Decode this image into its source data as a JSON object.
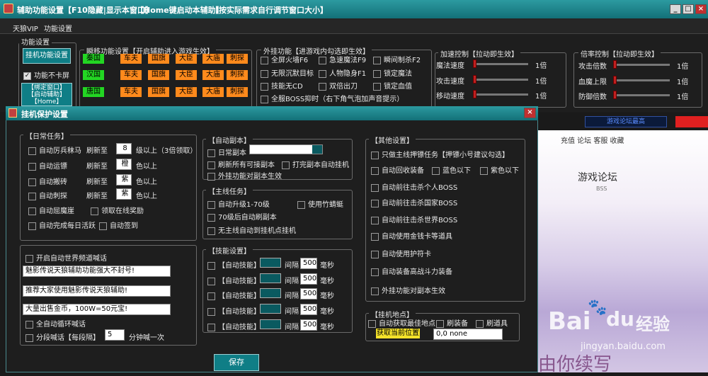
{
  "main_window": {
    "title": "辅助功能设置",
    "hint1": "【F10隐藏|显示本窗口】",
    "hint2": "【Home键启动本辅助】",
    "hint3": "【按实际需求自行调节窗口大小】",
    "min": "_",
    "max": "□",
    "close": "×"
  },
  "menu": [
    "天狼VIP",
    "功能设置"
  ],
  "func_group": {
    "label": "功能设置",
    "hang_button": "挂机功能设置",
    "no_flicker": "功能不卡屏",
    "bind_button": "【绑定窗口】\n【启动辅助】\n【Home】"
  },
  "instant": {
    "label": "瞬移功能设置【开启辅助进入游戏生效】",
    "row1": [
      "秦国",
      "车夫",
      "国旗",
      "大臣",
      "大庙",
      "刺探"
    ],
    "row2": [
      "汉国",
      "车夫",
      "国旗",
      "大臣",
      "大庙",
      "刺探"
    ],
    "row3": [
      "唐国",
      "车夫",
      "国旗",
      "大臣",
      "大庙",
      "刺探"
    ]
  },
  "plugin": {
    "label": "外挂功能【进游戏内勾选即生效】",
    "items": [
      "全屏火墙F6",
      "急速魔法F9",
      "瞬间制杀F2",
      "无限沉默目标",
      "人物隐身F1",
      "锁定魔法",
      "技能无CD",
      "双倍出刀",
      "锁定血值"
    ],
    "boss": "全服BOSS抑时（右下角气泡加声音提示）"
  },
  "speed": {
    "label": "加速控制【拉动即生效】",
    "rows": [
      {
        "label": "魔法速度",
        "value": "1倍"
      },
      {
        "label": "攻击速度",
        "value": "1倍"
      },
      {
        "label": "移动速度",
        "value": "1倍"
      }
    ]
  },
  "mult": {
    "label": "倍率控制【拉动即生效】",
    "rows": [
      {
        "label": "攻击倍数",
        "value": "1倍"
      },
      {
        "label": "血魔上限",
        "value": "1倍"
      },
      {
        "label": "防御倍数",
        "value": "1倍"
      }
    ]
  },
  "bg_links": "充值 论坛 客服 收藏",
  "bg_forum": "游戏论坛",
  "bg_bss": "BSS",
  "bg_strip": "游戏论坛最高",
  "watermark": {
    "brand": "Bai",
    "paw": "du",
    "jingyan": "经验",
    "url": "jingyan.baidu.com",
    "bottom": "由你续写"
  },
  "dialog": {
    "title": "挂机保护设置",
    "close": "×",
    "daily": {
      "label": "【日常任务】",
      "r1": {
        "check": "自动厉兵秣马",
        "mid": "刷新至",
        "val": "8",
        "tail": "级以上（3倍领取）"
      },
      "r2": {
        "check": "自动运镖",
        "mid": "刷新至",
        "val": "橙",
        "tail": "色以上"
      },
      "r3": {
        "check": "自动搬砖",
        "mid": "刷新至",
        "val": "紫",
        "tail": "色以上"
      },
      "r4": {
        "check": "自动刺探",
        "mid": "刷新至",
        "val": "紫",
        "tail": "色以上"
      },
      "demon": "自动屈魔崖",
      "reward": "领取在线奖励",
      "activity": "自动完成每日活跃",
      "signin": "自动签到"
    },
    "shout": {
      "check": "开启自动世界频道喊话",
      "msgs": [
        "魅影传说天狼辅助功能强大不封号!",
        "推荐大家使用魅影传说天狼辅助!",
        "大量出售金币，100W=50元宝!"
      ],
      "loop": "全自动循环喊话",
      "seg": "分段喊话【每段隔】",
      "interval": "5",
      "unit": "分钟喊一次"
    },
    "copy": {
      "label": "【自动副本】",
      "daily": "日常副本",
      "refresh": "刷新所有可接副本",
      "crash": "打完副本自动挂机",
      "plugin": "外挂功能对副本生效"
    },
    "main": {
      "label": "【主线任务】",
      "upgrade": "自动升级1-70级",
      "bamboo": "使用竹蜻蜓",
      "after70": "70级后自动刷副本",
      "notask": "无主线自动到挂机点挂机"
    },
    "skills": {
      "label": "【技能设置】",
      "items": [
        {
          "name": "【自动技能】",
          "gap": "间隔",
          "ms": "500",
          "unit": "毫秒"
        },
        {
          "name": "【自动技能】",
          "gap": "间隔",
          "ms": "500",
          "unit": "毫秒"
        },
        {
          "name": "【自动技能】",
          "gap": "间隔",
          "ms": "500",
          "unit": "毫秒"
        },
        {
          "name": "【自动技能】",
          "gap": "间隔",
          "ms": "500",
          "unit": "毫秒"
        },
        {
          "name": "【自动技能】",
          "gap": "间隔",
          "ms": "500",
          "unit": "毫秒"
        }
      ]
    },
    "other": {
      "label": "【其他设置】",
      "items": [
        "只做主线押镖任务【押镖小号建议勾选】",
        "自动回收装备",
        "自动前往击杀个人BOSS",
        "自动前往击杀国家BOSS",
        "自动前往击杀世界BOSS",
        "自动使用金钱卡等道具",
        "自动使用护符卡",
        "自动装备高战斗力装备",
        "外挂功能对副本生效"
      ],
      "blue": "蓝色以下",
      "purple": "紫色以下"
    },
    "hang": {
      "label": "【挂机地点】",
      "best": "自动获取最佳地点",
      "equip": "刷装备",
      "prop": "刷道具",
      "getpos": "获取当前位置",
      "coords": "0,0 none"
    },
    "save": "保存"
  }
}
